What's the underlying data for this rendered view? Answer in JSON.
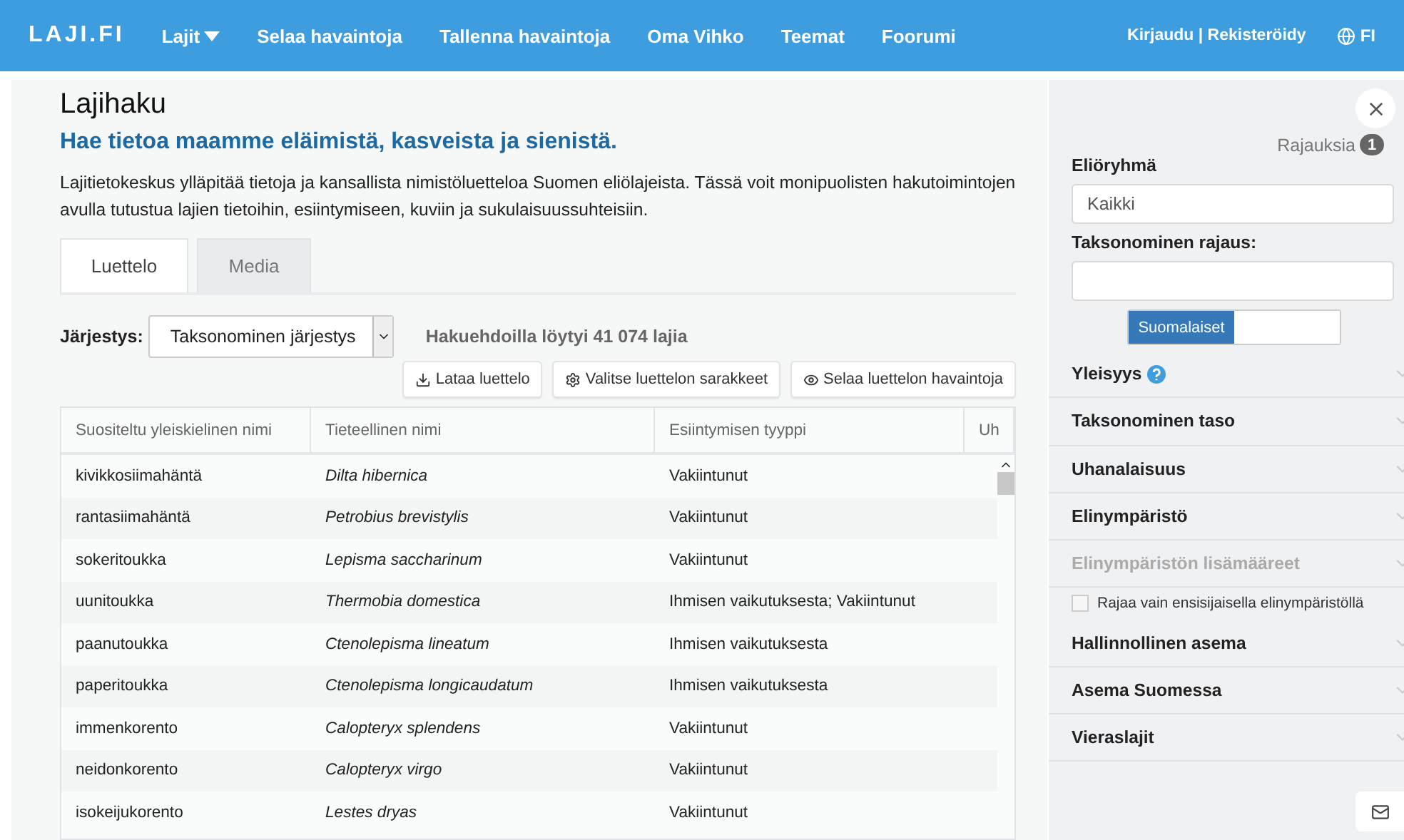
{
  "navbar": {
    "logo": "LAJI.FI",
    "menu": [
      {
        "label": "Lajit",
        "dropdown": true
      },
      {
        "label": "Selaa havaintoja",
        "dropdown": false
      },
      {
        "label": "Tallenna havaintoja",
        "dropdown": false
      },
      {
        "label": "Oma Vihko",
        "dropdown": false
      },
      {
        "label": "Teemat",
        "dropdown": false
      },
      {
        "label": "Foorumi",
        "dropdown": false
      }
    ],
    "login": "Kirjaudu | Rekisteröidy",
    "language": "FI"
  },
  "main": {
    "title": "Lajihaku",
    "subtitle": "Hae tietoa maamme eläimistä, kasveista ja sienistä.",
    "intro": "Lajitietokeskus ylläpitää tietoja ja kansallista nimistöluetteloa Suomen eliölajeista. Tässä voit monipuolisten hakutoimintojen avulla tutustua lajien tietoihin, esiintymiseen, kuviin ja sukulaisuussuhteisiin.",
    "tabs": [
      {
        "label": "Luettelo",
        "selected": true
      },
      {
        "label": "Media",
        "selected": false
      }
    ],
    "sort": {
      "label": "Järjestys:",
      "value": "Taksonominen järjestys"
    },
    "result_count": "Hakuehdoilla löytyi 41 074 lajia",
    "actions": [
      "Lataa luettelo",
      "Valitse luettelon sarakkeet",
      "Selaa luettelon havaintoja"
    ],
    "table": {
      "columns": [
        "Suositeltu yleiskielinen nimi",
        "Tieteellinen nimi",
        "Esiintymisen tyyppi",
        "Uh"
      ],
      "rows": [
        [
          "kivikkosiimahäntä",
          "Dilta hibernica",
          "Vakiintunut"
        ],
        [
          "rantasiimahäntä",
          "Petrobius brevistylis",
          "Vakiintunut"
        ],
        [
          "sokeritoukka",
          "Lepisma saccharinum",
          "Vakiintunut"
        ],
        [
          "uunitoukka",
          "Thermobia domestica",
          "Ihmisen vaikutuksesta; Vakiintunut"
        ],
        [
          "paanutoukka",
          "Ctenolepisma lineatum",
          "Ihmisen vaikutuksesta"
        ],
        [
          "paperitoukka",
          "Ctenolepisma longicaudatum",
          "Ihmisen vaikutuksesta"
        ],
        [
          "immenkorento",
          "Calopteryx splendens",
          "Vakiintunut"
        ],
        [
          "neidonkorento",
          "Calopteryx virgo",
          "Vakiintunut"
        ],
        [
          "isokeijukorento",
          "Lestes dryas",
          "Vakiintunut"
        ]
      ]
    }
  },
  "filters": {
    "active_label": "Rajauksia",
    "active_count": "1",
    "group_label": "Eliöryhmä",
    "group_value": "Kaikki",
    "taxon_label": "Taksonominen rajaus:",
    "toggle": [
      {
        "label": "Suomalaiset",
        "selected": true
      },
      {
        "selected": false
      }
    ],
    "items": [
      {
        "kind": "section",
        "label": "Yleisyys",
        "help": true,
        "disabled": false
      },
      {
        "kind": "section",
        "label": "Taksonominen taso",
        "help": false,
        "disabled": false
      },
      {
        "kind": "section",
        "label": "Uhanalaisuus",
        "help": false,
        "disabled": false
      },
      {
        "kind": "section",
        "label": "Elinympäristö",
        "help": false,
        "disabled": false
      },
      {
        "kind": "section",
        "label": "Elinympäristön lisämääreet",
        "help": false,
        "disabled": true
      },
      {
        "kind": "checkbox",
        "label": "Rajaa vain ensisijaisella elinympäristöllä",
        "checked": false
      },
      {
        "kind": "section",
        "label": "Hallinnollinen asema",
        "help": false,
        "disabled": false
      },
      {
        "kind": "section",
        "label": "Asema Suomessa",
        "help": false,
        "disabled": false
      },
      {
        "kind": "section",
        "label": "Vieraslajit",
        "help": false,
        "disabled": false
      }
    ]
  }
}
